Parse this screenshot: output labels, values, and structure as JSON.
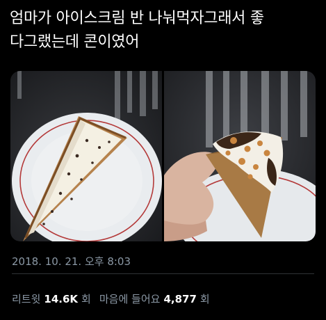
{
  "tweet": {
    "text": "엄마가 아이스크림 반 나눠먹자그래서 좋\n다그랬는데 콘이였어",
    "media": [
      {
        "icon": "photo-ice-cream-cake-slice"
      },
      {
        "icon": "photo-ice-cream-cone-half"
      }
    ],
    "timestamp": "2018. 10. 21. 오후 8:03"
  },
  "stats": {
    "retweets_label": "리트윗",
    "retweets_value": "14.6K",
    "retweets_unit": "회",
    "likes_label": "마음에 들어요",
    "likes_value": "4,877",
    "likes_unit": "회"
  },
  "colors": {
    "background": "#000000",
    "text_primary": "#ffffff",
    "text_secondary": "#8b98a5",
    "divider": "#2f3336"
  }
}
